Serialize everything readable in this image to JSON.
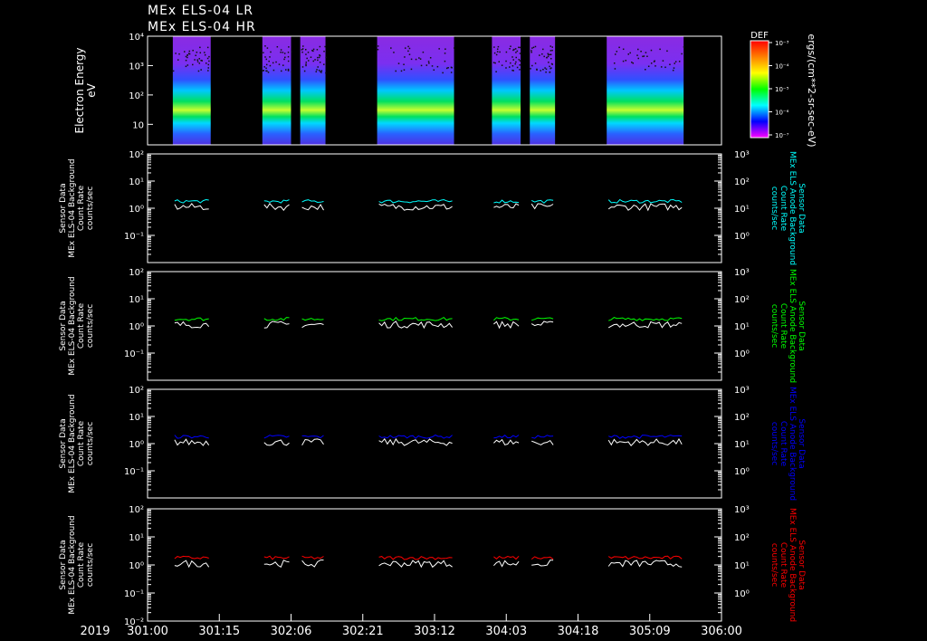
{
  "titles": [
    "MEx ELS-04 LR",
    "MEx ELS-04 HR"
  ],
  "colorbar": {
    "label": "DEF",
    "ticks": [
      "10⁻³",
      "10⁻⁴",
      "10⁻⁵",
      "10⁻⁶",
      "10⁻⁷"
    ],
    "units": "ergs/(cm**2-sr-sec-eV)"
  },
  "time_axis": {
    "year": "2019",
    "ticks": [
      "301:00",
      "301:15",
      "302:06",
      "302:21",
      "303:12",
      "304:03",
      "304:18",
      "305:09",
      "306:00"
    ]
  },
  "chart_data": [
    {
      "type": "heatmap",
      "ylabel": [
        "Electron Energy",
        "eV"
      ],
      "y_ticks": [
        "10⁴",
        "10³",
        "10²",
        "10"
      ],
      "ylim": [
        2,
        10000
      ],
      "yscale": "log",
      "data_intervals": [
        [
          301.22,
          301.55
        ],
        [
          302.0,
          302.25
        ],
        [
          302.33,
          302.55
        ],
        [
          303.0,
          303.67
        ],
        [
          304.0,
          304.25
        ],
        [
          304.33,
          304.55
        ],
        [
          305.0,
          305.67
        ]
      ],
      "colors": [
        "#ff00ff",
        "#0000ff",
        "#00ffff",
        "#00ff00",
        "#ffff00",
        "#ff8000",
        "#ff0000"
      ]
    },
    {
      "type": "line",
      "ylabel": [
        "Sensor Data",
        "MEx ELS-04 Background",
        "Count Rate",
        "counts/sec"
      ],
      "ylabel_right": [
        "Sensor Data",
        "MEx ELS Anode Background",
        "Count Rate",
        "counts/sec"
      ],
      "y_ticks": [
        "10²",
        "10¹",
        "10⁰",
        "10⁻¹"
      ],
      "y2_ticks": [
        "10³",
        "10²",
        "10¹",
        "10⁰"
      ],
      "ylim": [
        0.01,
        100
      ],
      "yscale": "log",
      "series": [
        {
          "name": "",
          "color": "#00ffff",
          "level": 1.8
        },
        {
          "name": "",
          "color": "#ffffff",
          "level": 1.0
        }
      ]
    },
    {
      "type": "line",
      "ylabel": [
        "Sensor Data",
        "MEx ELS-04 Background",
        "Count Rate",
        "counts/sec"
      ],
      "ylabel_right": [
        "Sensor Data",
        "MEx ELS Anode Background",
        "Count Rate",
        "counts/sec"
      ],
      "y_ticks": [
        "10²",
        "10¹",
        "10⁰",
        "10⁻¹"
      ],
      "y2_ticks": [
        "10³",
        "10²",
        "10¹",
        "10⁰"
      ],
      "ylim": [
        0.01,
        100
      ],
      "yscale": "log",
      "series": [
        {
          "name": "",
          "color": "#00ff00",
          "level": 1.8
        },
        {
          "name": "",
          "color": "#ffffff",
          "level": 1.0
        }
      ]
    },
    {
      "type": "line",
      "ylabel": [
        "Sensor Data",
        "MEx ELS-04 Background",
        "Count Rate",
        "counts/sec"
      ],
      "ylabel_right": [
        "Sensor Data",
        "MEx ELS Anode Background",
        "Count Rate",
        "counts/sec"
      ],
      "y_ticks": [
        "10²",
        "10¹",
        "10⁰",
        "10⁻¹"
      ],
      "y2_ticks": [
        "10³",
        "10²",
        "10¹",
        "10⁰"
      ],
      "ylim": [
        0.01,
        100
      ],
      "yscale": "log",
      "series": [
        {
          "name": "",
          "color": "#0000ff",
          "level": 1.8
        },
        {
          "name": "",
          "color": "#ffffff",
          "level": 1.0
        }
      ]
    },
    {
      "type": "line",
      "ylabel": [
        "Sensor Data",
        "MEx ELS-04 Background",
        "Count Rate",
        "counts/sec"
      ],
      "ylabel_right": [
        "Sensor Data",
        "MEx ELS Anode Background",
        "Count Rate",
        "counts/sec"
      ],
      "y_ticks": [
        "10²",
        "10¹",
        "10⁰",
        "10⁻¹",
        "10⁻²"
      ],
      "y2_ticks": [
        "10³",
        "10²",
        "10¹",
        "10⁰"
      ],
      "ylim": [
        0.01,
        100
      ],
      "yscale": "log",
      "series": [
        {
          "name": "",
          "color": "#ff0000",
          "level": 1.8
        },
        {
          "name": "",
          "color": "#ffffff",
          "level": 1.0
        }
      ]
    }
  ]
}
